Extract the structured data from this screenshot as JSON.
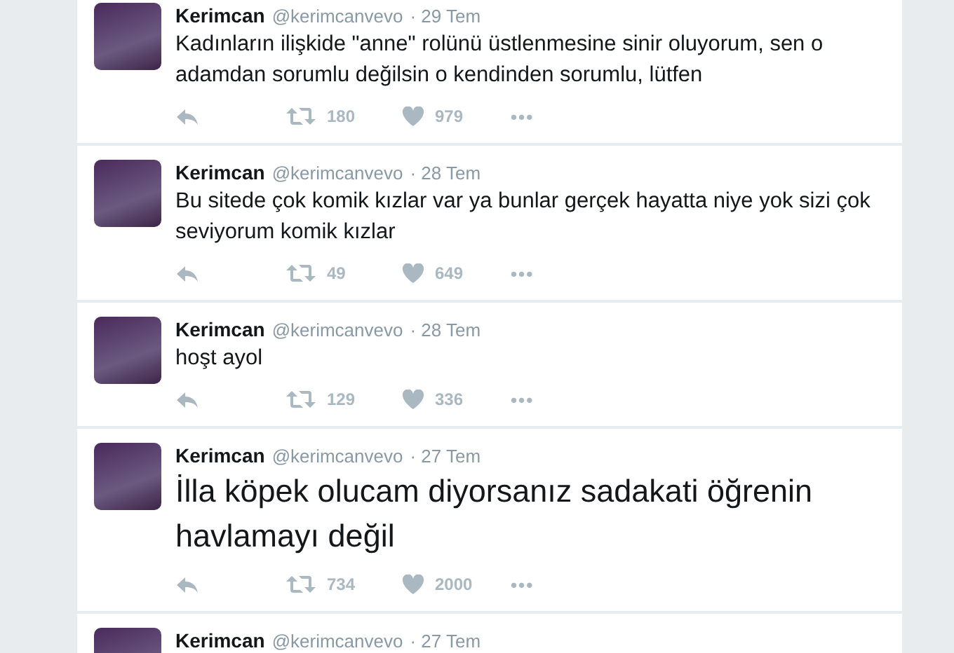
{
  "tweets": [
    {
      "name": "Kerimcan",
      "handle": "@kerimcanvevo",
      "date": "· 29 Tem",
      "kind": "normal",
      "text": "Kadınların ilişkide \"anne\" rolünü üstlenmesine sinir oluyorum, sen o adamdan sorumlu değilsin o kendinden sorumlu, lütfen",
      "retweets": "180",
      "likes": "979",
      "more": "•••"
    },
    {
      "name": "Kerimcan",
      "handle": "@kerimcanvevo",
      "date": "· 28 Tem",
      "kind": "normal",
      "text": "Bu sitede çok komik kızlar var ya bunlar gerçek hayatta niye yok sizi çok seviyorum komik kızlar",
      "retweets": "49",
      "likes": "649",
      "more": "•••"
    },
    {
      "name": "Kerimcan",
      "handle": "@kerimcanvevo",
      "date": "· 28 Tem",
      "kind": "normal",
      "text": "hoşt ayol",
      "retweets": "129",
      "likes": "336",
      "more": "•••"
    },
    {
      "name": "Kerimcan",
      "handle": "@kerimcanvevo",
      "date": "· 27 Tem",
      "kind": "large",
      "text": "İlla köpek olucam diyorsanız sadakati öğrenin havlamayı değil",
      "retweets": "734",
      "likes": "2000",
      "more": "•••"
    },
    {
      "name": "Kerimcan",
      "handle": "@kerimcanvevo",
      "date": "· 27 Tem"
    }
  ]
}
